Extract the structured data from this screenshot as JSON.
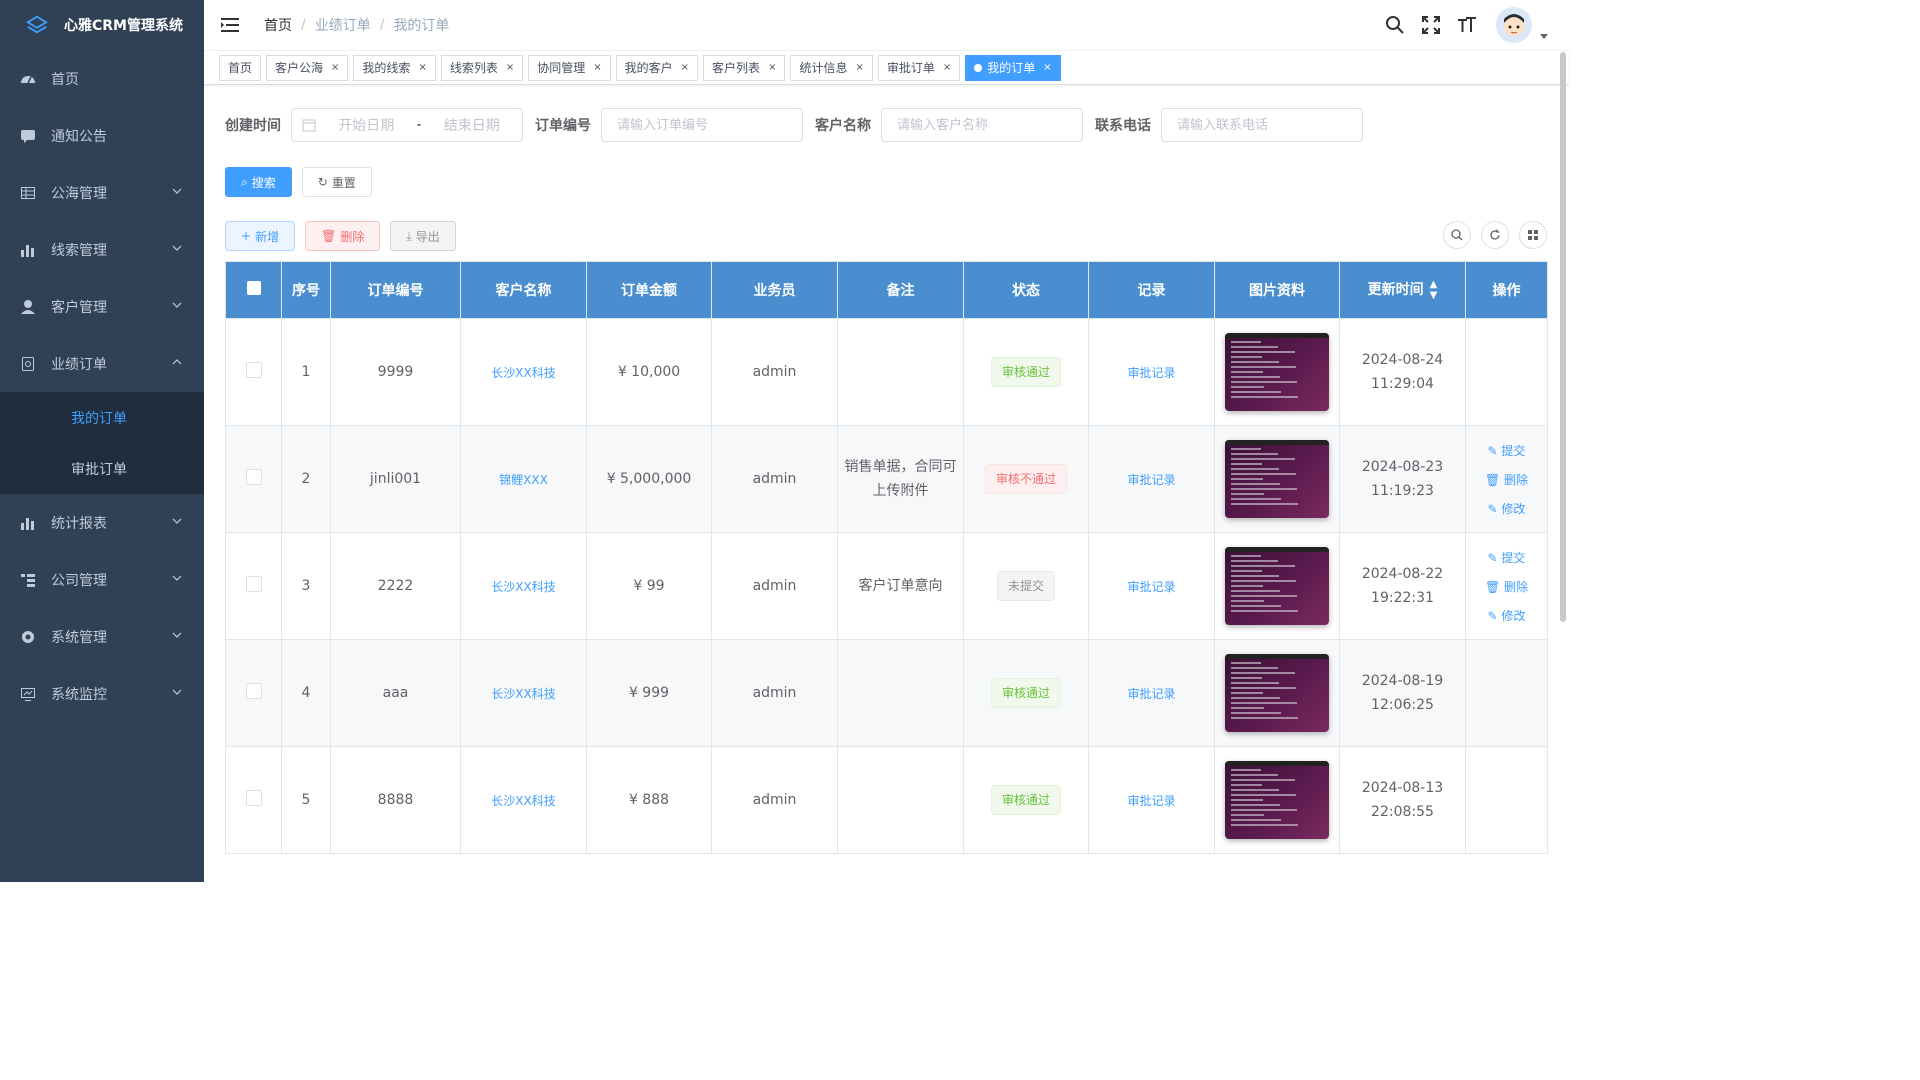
{
  "app": {
    "title": "心雅CRM管理系统"
  },
  "sidebar": {
    "items": [
      {
        "label": "首页",
        "icon": "dashboard-icon"
      },
      {
        "label": "通知公告",
        "icon": "message-icon"
      },
      {
        "label": "公海管理",
        "icon": "table-icon"
      },
      {
        "label": "线索管理",
        "icon": "chart-icon"
      },
      {
        "label": "客户管理",
        "icon": "user-icon"
      },
      {
        "label": "业绩订单",
        "icon": "order-icon"
      },
      {
        "label": "统计报表",
        "icon": "chart-icon"
      },
      {
        "label": "公司管理",
        "icon": "tree-icon"
      },
      {
        "label": "系统管理",
        "icon": "gear-icon"
      },
      {
        "label": "系统监控",
        "icon": "monitor-icon"
      }
    ],
    "sub": [
      {
        "label": "我的订单"
      },
      {
        "label": "审批订单"
      }
    ]
  },
  "breadcrumb": [
    "首页",
    "业绩订单",
    "我的订单"
  ],
  "tags": [
    "首页",
    "客户公海",
    "我的线索",
    "线索列表",
    "协同管理",
    "我的客户",
    "客户列表",
    "统计信息",
    "审批订单",
    "我的订单"
  ],
  "filters": {
    "create_time_label": "创建时间",
    "start_placeholder": "开始日期",
    "range_sep": "-",
    "end_placeholder": "结束日期",
    "order_no_label": "订单编号",
    "order_no_placeholder": "请输入订单编号",
    "customer_label": "客户名称",
    "customer_placeholder": "请输入客户名称",
    "phone_label": "联系电话",
    "phone_placeholder": "请输入联系电话"
  },
  "buttons": {
    "search": "搜索",
    "reset": "重置",
    "add": "新增",
    "delete": "删除",
    "export": "导出"
  },
  "table": {
    "headers": [
      "序号",
      "订单编号",
      "客户名称",
      "订单金额",
      "业务员",
      "备注",
      "状态",
      "记录",
      "图片资料",
      "更新时间",
      "操作"
    ],
    "record_link": "审批记录",
    "ops": {
      "submit": "提交",
      "delete": "删除",
      "edit": "修改"
    },
    "rows": [
      {
        "idx": "1",
        "order_no": "9999",
        "customer": "长沙XX科技",
        "amount": "¥ 10,000",
        "salesman": "admin",
        "remark": "",
        "status": "审核通过",
        "status_type": "success",
        "updated": "2024-08-24 11:29:04"
      },
      {
        "idx": "2",
        "order_no": "jinli001",
        "customer": "锦鲤XXX",
        "amount": "¥ 5,000,000",
        "salesman": "admin",
        "remark": "销售单据，合同可上传附件",
        "status": "审核不通过",
        "status_type": "danger",
        "updated": "2024-08-23 11:19:23"
      },
      {
        "idx": "3",
        "order_no": "2222",
        "customer": "长沙XX科技",
        "amount": "¥ 99",
        "salesman": "admin",
        "remark": "客户订单意向",
        "status": "未提交",
        "status_type": "info",
        "updated": "2024-08-22 19:22:31"
      },
      {
        "idx": "4",
        "order_no": "aaa",
        "customer": "长沙XX科技",
        "amount": "¥ 999",
        "salesman": "admin",
        "remark": "",
        "status": "审核通过",
        "status_type": "success",
        "updated": "2024-08-19 12:06:25"
      },
      {
        "idx": "5",
        "order_no": "8888",
        "customer": "长沙XX科技",
        "amount": "¥ 888",
        "salesman": "admin",
        "remark": "",
        "status": "审核通过",
        "status_type": "success",
        "updated": "2024-08-13 22:08:55"
      }
    ]
  },
  "colors": {
    "sidebar_bg": "#304156",
    "accent": "#409eff",
    "table_header": "#4a8ed0"
  }
}
